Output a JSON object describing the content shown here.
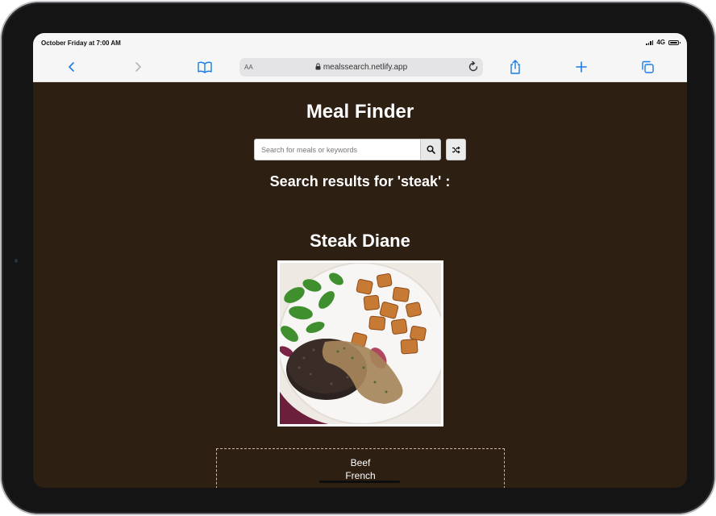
{
  "status_bar": {
    "time": "October Friday at 7:00 AM",
    "network": "4G"
  },
  "browser": {
    "text_size_label": "AA",
    "url": "mealssearch.netlify.app",
    "icons": {
      "back": "chevron-left-icon",
      "forward": "chevron-right-icon",
      "bookmarks": "book-icon",
      "lock": "lock-icon",
      "reload": "reload-icon",
      "share": "share-icon",
      "new_tab": "plus-icon",
      "tabs": "tabs-icon"
    }
  },
  "app": {
    "title": "Meal Finder",
    "search": {
      "placeholder": "Search for meals or keywords",
      "value": ""
    },
    "search_button_icon": "search-icon",
    "random_button_icon": "shuffle-icon",
    "results_heading": "Search results for 'steak' :"
  },
  "meal": {
    "name": "Steak Diane",
    "category": "Beef",
    "area": "French"
  },
  "colors": {
    "page_background": "#2e1f13",
    "browser_chrome": "#f6f6f6",
    "accent": "#1a7be6",
    "text": "#ffffff"
  }
}
